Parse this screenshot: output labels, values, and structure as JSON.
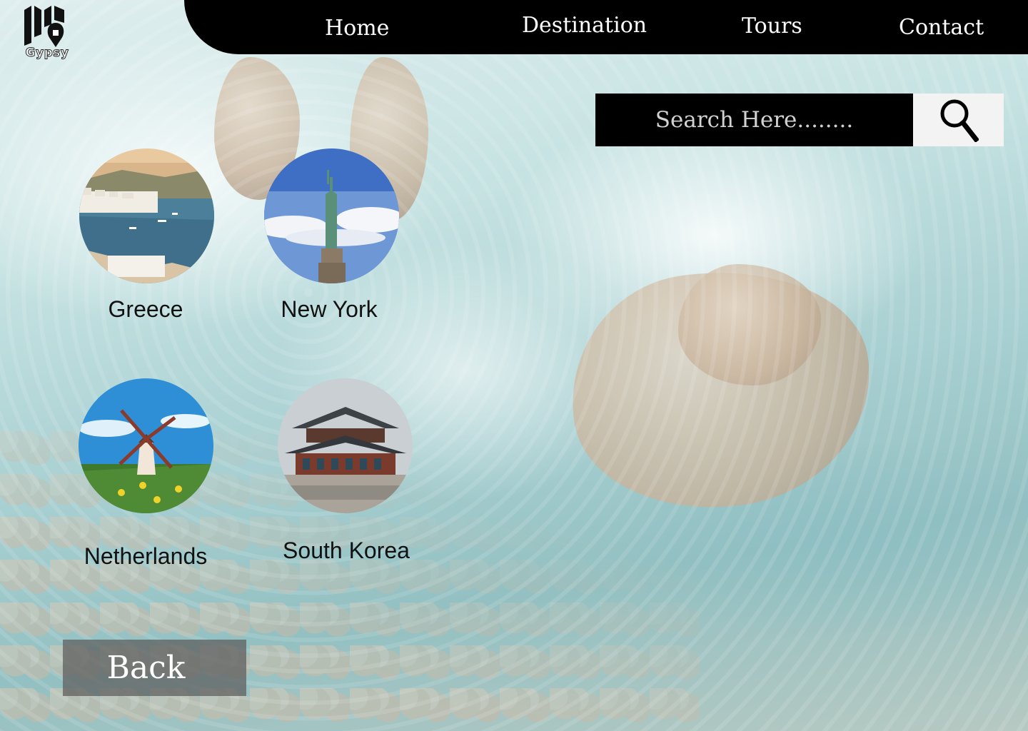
{
  "brand": {
    "logo_text": "Gypsy"
  },
  "nav": {
    "home": "Home",
    "destination": "Destination",
    "tours": "Tours",
    "contact": "Contact"
  },
  "search": {
    "placeholder": "Search Here........",
    "value": ""
  },
  "destinations": [
    {
      "label": "Greece"
    },
    {
      "label": "New York"
    },
    {
      "label": "Netherlands"
    },
    {
      "label": "South Korea"
    }
  ],
  "back_label": "Back",
  "colors": {
    "nav_bg": "#000000",
    "nav_text": "#ffffff",
    "search_bg": "#000000",
    "search_button_bg": "#f3f3f3"
  },
  "icons": {
    "search": "magnifier-icon",
    "logo": "map-pin-logo"
  }
}
